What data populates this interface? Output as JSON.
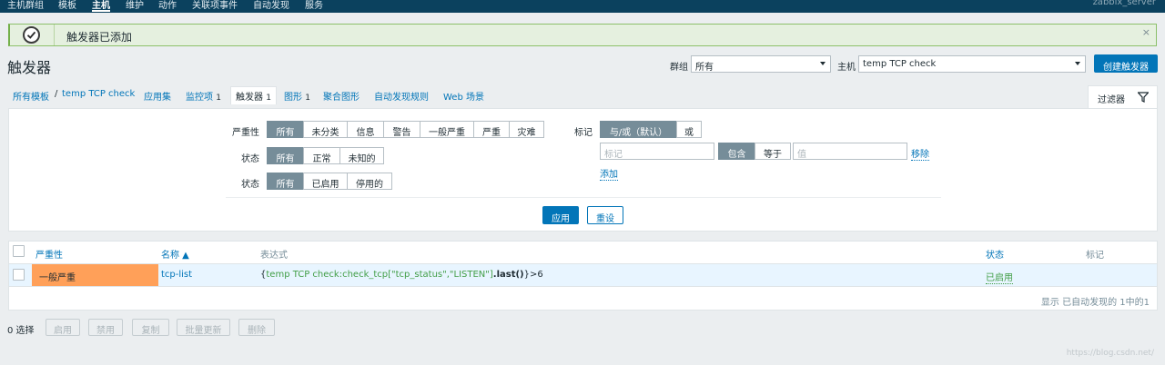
{
  "topnav": {
    "items": [
      "主机群组",
      "模板",
      "主机",
      "维护",
      "动作",
      "关联项事件",
      "自动发现",
      "服务"
    ],
    "active_index": 2,
    "server": "zabbix_server"
  },
  "message": {
    "text": "触发器已添加",
    "close": "×"
  },
  "page": {
    "title": "触发器",
    "group_label": "群组",
    "group_value": "所有",
    "host_label": "主机",
    "host_value": "temp TCP check",
    "create_button": "创建触发器"
  },
  "tabs": {
    "all_templates": "所有模板",
    "host": "temp TCP check",
    "applications": "应用集",
    "items": "监控项",
    "items_count": "1",
    "triggers": "触发器",
    "triggers_count": "1",
    "graphs": "图形",
    "graphs_count": "1",
    "screens": "聚合图形",
    "discovery": "自动发现规则",
    "web": "Web 场景",
    "filter": "过滤器"
  },
  "filter": {
    "severity_label": "严重性",
    "severity_options": [
      "所有",
      "未分类",
      "信息",
      "警告",
      "一般严重",
      "严重",
      "灾难"
    ],
    "state_label": "状态",
    "state_options": [
      "所有",
      "正常",
      "未知的"
    ],
    "status_label": "状态",
    "status_options": [
      "所有",
      "已启用",
      "停用的"
    ],
    "tags_label": "标记",
    "tags_mode_options": [
      "与/或（默认）",
      "或"
    ],
    "tag_placeholder": "标记",
    "tag_operator_options": [
      "包含",
      "等于"
    ],
    "value_placeholder": "值",
    "remove_link": "移除",
    "add_link": "添加",
    "apply_button": "应用",
    "reset_button": "重设"
  },
  "table": {
    "headers": {
      "severity": "严重性",
      "name": "名称 ▲",
      "expression": "表达式",
      "status": "状态",
      "tags": "标记"
    },
    "rows": [
      {
        "severity": "一般严重",
        "name": "tcp-list",
        "expr_open": "{",
        "expr_key": "temp TCP check:check_tcp[\"tcp_status\",\"LISTEN\"]",
        "expr_func": ".last()",
        "expr_close": "}",
        "expr_tail": ">6",
        "status": "已启用"
      }
    ],
    "footer": "显示 已自动发现的 1中的1"
  },
  "bottom": {
    "selected": "0 选择",
    "buttons": [
      "启用",
      "禁用",
      "复制",
      "批量更新",
      "删除"
    ]
  },
  "watermark": "https://blog.csdn.net/",
  "colors": {
    "topnav": "#0b415e",
    "accent": "#0275b8",
    "severity_average": "#ffa059",
    "status_enabled": "#429e47",
    "success_bg": "#e5f0df"
  }
}
